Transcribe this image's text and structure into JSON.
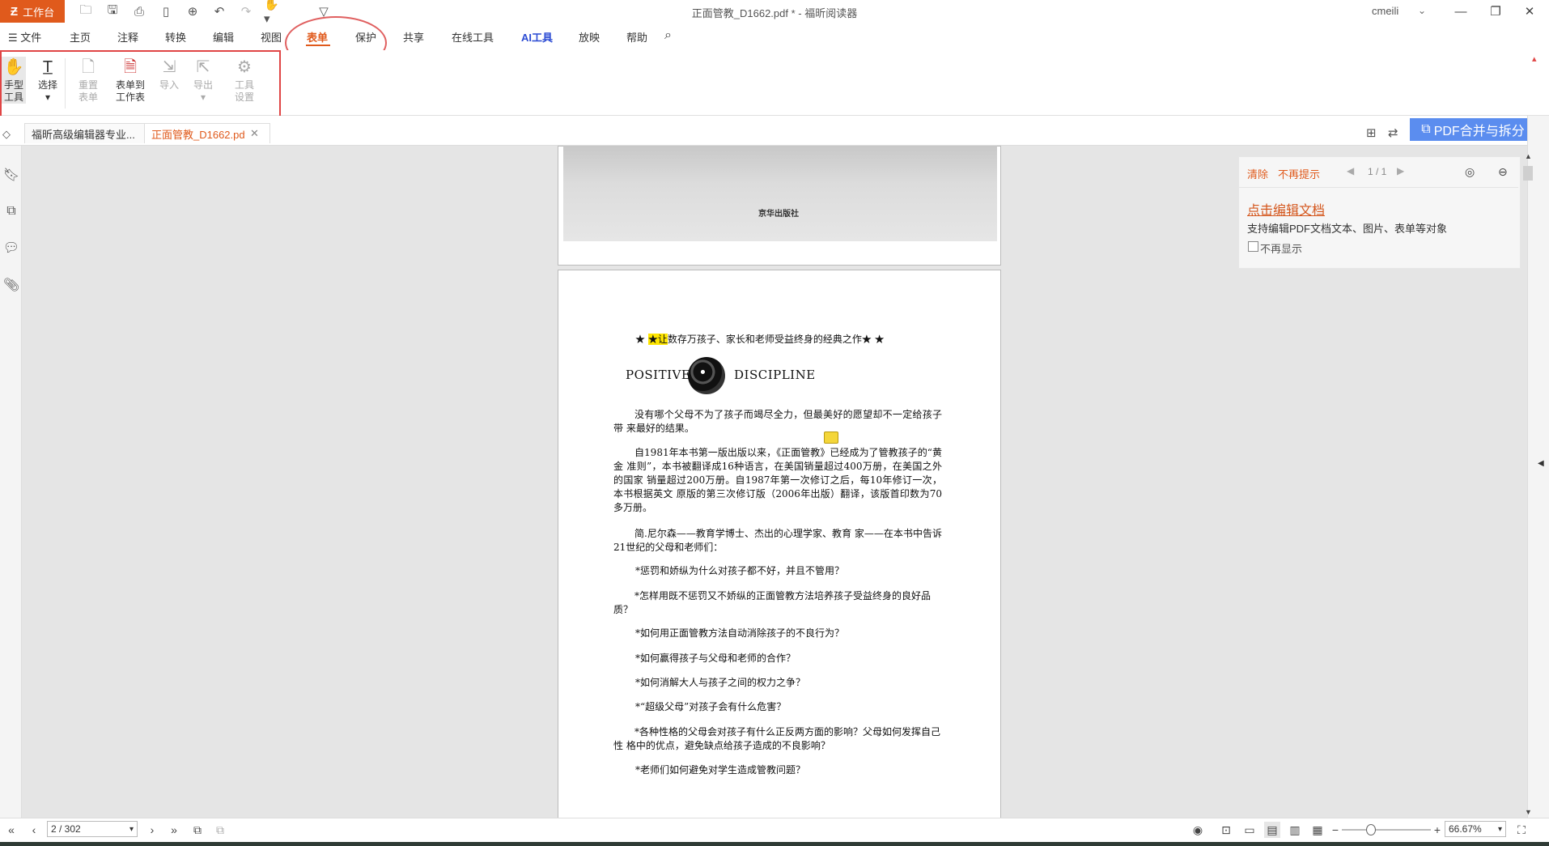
{
  "titlebar": {
    "workbench_label": "工作台",
    "doc_title": "正面管教_D1662.pdf * - 福昕阅读器",
    "user": "cmeili"
  },
  "menu_tabs": [
    {
      "label": "文件"
    },
    {
      "label": "主页"
    },
    {
      "label": "注释"
    },
    {
      "label": "转换"
    },
    {
      "label": "编辑"
    },
    {
      "label": "视图"
    },
    {
      "label": "表单"
    },
    {
      "label": "保护"
    },
    {
      "label": "共享"
    },
    {
      "label": "在线工具"
    },
    {
      "label": "AI工具"
    },
    {
      "label": "放映"
    },
    {
      "label": "帮助"
    }
  ],
  "ribbon": {
    "hand_tool": [
      "手型",
      "工具"
    ],
    "select": "选择",
    "reset_form": [
      "重置",
      "表单"
    ],
    "form_to_sheet": [
      "表单到",
      "工作表"
    ],
    "import": "导入",
    "export": "导出",
    "tool_settings": [
      "工具",
      "设置"
    ]
  },
  "doc_tabs": [
    {
      "label": "福昕高级编辑器专业..."
    },
    {
      "label": "正面管教_D1662.pdf"
    }
  ],
  "pdf_merge_label": "PDF合并与拆分",
  "page1": {
    "publisher": "京华出版社"
  },
  "page2": {
    "tagline_star": "★",
    "tagline_highlight": "★让",
    "tagline_rest": "数存万孩子、家长和老师受益终身的经典之作★ ★",
    "pd_left": "POSITIVE",
    "pd_right": "DISCIPLINE",
    "paragraphs": [
      "没有哪个父母不为了孩子而竭尽全力，但最美好的愿望却不一定给孩子带 来最好的结果。",
      "自1981年本书第一版出版以来，《正面管教》已经成为了管教孩子的“黄金 准则”，本书被翻译成16种语言，在美国销量超过400万册，在美国之外的国家 销量超过200万册。自1987年第一次修订之后，每10年修订一次，本书根据英文 原版的第三次修订版（2006年出版）翻译，该版首印数为70多万册。",
      "简.尼尔森——教育学博士、杰出的心理学家、教育 家——在本书中告诉21世纪的父母和老师们："
    ],
    "bullets": [
      "*惩罚和娇纵为什么对孩子都不好，并且不管用？",
      "*怎样用既不惩罚又不娇纵的正面管教方法培养孩子受益终身的良好品质？",
      "*如何用正面管教方法自动消除孩子的不良行为？",
      "*如何赢得孩子与父母和老师的合作？",
      "*如何消解大人与孩子之间的权力之争？",
      "*“超级父母”对孩子会有什么危害？",
      "*各种性格的父母会对孩子有什么正反两方面的影响？父母如何发挥自己性 格中的优点，避免缺点给孩子造成的不良影响？",
      "*老师们如何避免对学生造成管教问题？"
    ]
  },
  "notice": {
    "clear": "清除",
    "no_remind": "不再提示",
    "pager": "1 / 1",
    "link": "点击编辑文档",
    "desc": "支持编辑PDF文档文本、图片、表单等对象",
    "checkbox_label": "不再显示"
  },
  "status": {
    "page": "2 / 302",
    "zoom": "66.67%"
  },
  "colors": {
    "accent": "#e05a1c",
    "annotation_red": "#e04545",
    "merge_button": "#5b8def"
  }
}
